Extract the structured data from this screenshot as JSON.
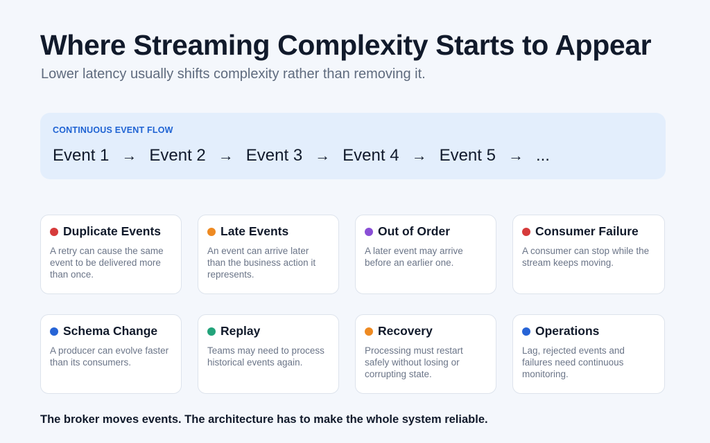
{
  "title": "Where Streaming Complexity Starts to Appear",
  "subtitle": "Lower latency usually shifts complexity rather than removing it.",
  "flow": {
    "label": "CONTINUOUS EVENT FLOW",
    "events": [
      "Event 1",
      "Event 2",
      "Event 3",
      "Event 4",
      "Event 5",
      "..."
    ],
    "arrow": "→"
  },
  "cards": [
    {
      "title": "Duplicate Events",
      "desc": "A retry can cause the same event to be delivered more than once.",
      "color": "#d63b3b",
      "icon": "red-dot-icon"
    },
    {
      "title": "Late Events",
      "desc": "An event can arrive later than the business action it represents.",
      "color": "#ee8a22",
      "icon": "orange-dot-icon"
    },
    {
      "title": "Out of Order",
      "desc": "A later event may arrive before an earlier one.",
      "color": "#8a4fd6",
      "icon": "purple-dot-icon"
    },
    {
      "title": "Consumer Failure",
      "desc": "A consumer can stop while the stream keeps moving.",
      "color": "#d63b3b",
      "icon": "red-dot-icon"
    },
    {
      "title": "Schema Change",
      "desc": "A producer can evolve faster than its consumers.",
      "color": "#2764d6",
      "icon": "blue-dot-icon"
    },
    {
      "title": "Replay",
      "desc": "Teams may need to process historical events again.",
      "color": "#22a37a",
      "icon": "green-dot-icon"
    },
    {
      "title": "Recovery",
      "desc": "Processing must restart safely without losing or corrupting state.",
      "color": "#ee8a22",
      "icon": "orange-dot-icon"
    },
    {
      "title": "Operations",
      "desc": "Lag, rejected events and failures need continuous monitoring.",
      "color": "#2764d6",
      "icon": "blue-dot-icon"
    }
  ],
  "footer": "The broker moves events. The architecture has to make the whole system reliable."
}
